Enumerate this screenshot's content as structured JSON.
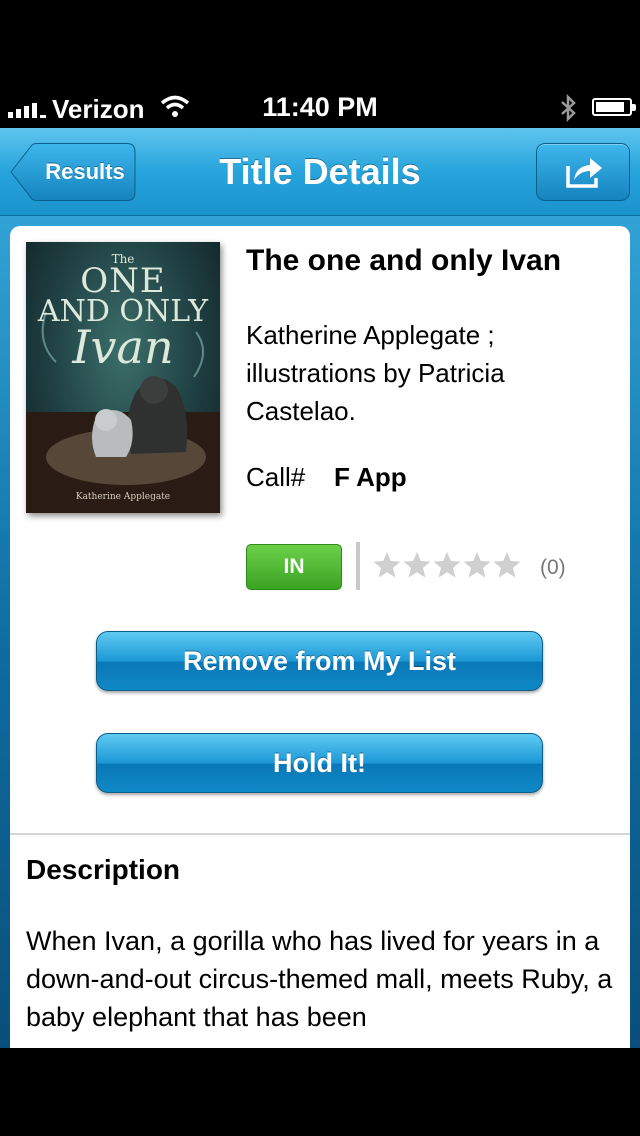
{
  "status_bar": {
    "carrier": "Verizon",
    "time": "11:40 PM"
  },
  "navbar": {
    "back_label": "Results",
    "title": "Title Details",
    "share_icon": "share-icon"
  },
  "book": {
    "title": "The one and only Ivan",
    "author": "Katherine Applegate ; illustrations by Patricia Castelao.",
    "call_label": "Call#",
    "call_number": "F App",
    "availability": "IN",
    "rating_count": "(0)",
    "rating_stars_filled": 0,
    "rating_stars_total": 5,
    "cover": {
      "the": "The",
      "one": "ONE",
      "and_only": "AND ONLY",
      "ivan": "Ivan",
      "author": "Katherine Applegate"
    }
  },
  "actions": {
    "remove_label": "Remove from My List",
    "hold_label": "Hold It!"
  },
  "description": {
    "heading": "Description",
    "text": "When Ivan, a gorilla who has lived for years in a down-and-out circus-themed mall, meets Ruby, a baby elephant that has been"
  },
  "colors": {
    "nav_blue": "#27a4dc",
    "in_green": "#3aa423",
    "button_blue": "#1b98d6"
  }
}
